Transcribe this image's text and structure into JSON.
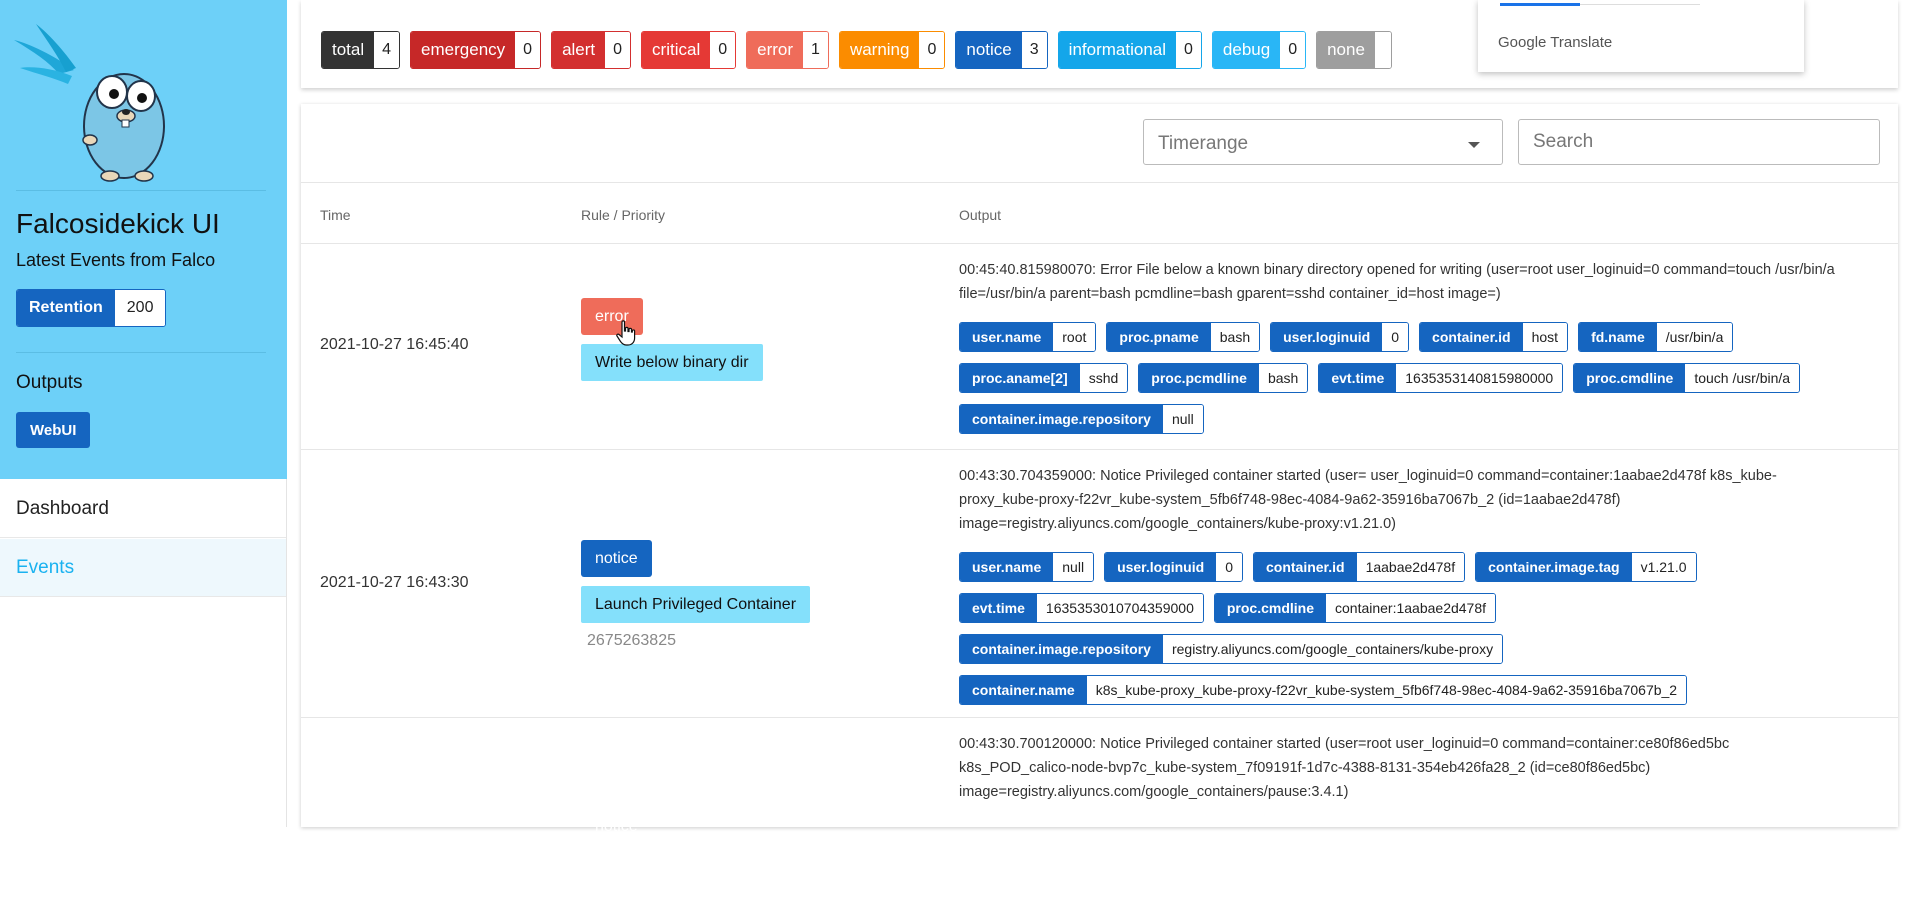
{
  "sidebar": {
    "title": "Falcosidekick UI",
    "subtitle": "Latest Events from Falco",
    "retention": {
      "label": "Retention",
      "value": "200"
    },
    "outputs_label": "Outputs",
    "outputs_button": "WebUI",
    "nav": [
      {
        "label": "Dashboard",
        "active": false
      },
      {
        "label": "Events",
        "active": true
      }
    ]
  },
  "priorities": [
    {
      "label": "total",
      "count": "4",
      "color": "#333333"
    },
    {
      "label": "emergency",
      "count": "0",
      "color": "#c62828"
    },
    {
      "label": "alert",
      "count": "0",
      "color": "#d32f2f"
    },
    {
      "label": "critical",
      "count": "0",
      "color": "#e53935"
    },
    {
      "label": "error",
      "count": "1",
      "color": "#ef6c5a"
    },
    {
      "label": "warning",
      "count": "0",
      "color": "#fb8c00"
    },
    {
      "label": "notice",
      "count": "3",
      "color": "#1565c0"
    },
    {
      "label": "informational",
      "count": "0",
      "color": "#14a6ea"
    },
    {
      "label": "debug",
      "count": "0",
      "color": "#29b6f6"
    },
    {
      "label": "none",
      "count": "",
      "color": "#9e9e9e"
    }
  ],
  "translate_popup": {
    "label": "Google Translate"
  },
  "filters": {
    "timerange_placeholder": "Timerange",
    "search_placeholder": "Search"
  },
  "table": {
    "headers": {
      "time": "Time",
      "rule": "Rule / Priority",
      "output": "Output"
    },
    "rows": [
      {
        "time": "2021-10-27 16:45:40",
        "priority": "error",
        "priority_color": "#ef6c5a",
        "rule": "Write below binary dir",
        "rule_id": "",
        "output": "00:45:40.815980070: Error File below a known binary directory opened for writing (user=root user_loginuid=0 command=touch /usr/bin/a file=/usr/bin/a parent=bash pcmdline=bash gparent=sshd container_id=host image=)",
        "fields": [
          {
            "k": "user.name",
            "v": "root"
          },
          {
            "k": "proc.pname",
            "v": "bash"
          },
          {
            "k": "user.loginuid",
            "v": "0"
          },
          {
            "k": "container.id",
            "v": "host"
          },
          {
            "k": "fd.name",
            "v": "/usr/bin/a"
          },
          {
            "k": "proc.aname[2]",
            "v": "sshd"
          },
          {
            "k": "proc.pcmdline",
            "v": "bash"
          },
          {
            "k": "evt.time",
            "v": "1635353140815980000"
          },
          {
            "k": "proc.cmdline",
            "v": "touch /usr/bin/a"
          },
          {
            "k": "container.image.repository",
            "v": "null"
          }
        ]
      },
      {
        "time": "2021-10-27 16:43:30",
        "priority": "notice",
        "priority_color": "#1565c0",
        "rule": "Launch Privileged Container",
        "rule_id": "2675263825",
        "output": "00:43:30.704359000: Notice Privileged container started (user= user_loginuid=0 command=container:1aabae2d478f k8s_kube-proxy_kube-proxy-f22vr_kube-system_5fb6f748-98ec-4084-9a62-35916ba7067b_2 (id=1aabae2d478f) image=registry.aliyuncs.com/google_containers/kube-proxy:v1.21.0)",
        "fields": [
          {
            "k": "user.name",
            "v": "null"
          },
          {
            "k": "user.loginuid",
            "v": "0"
          },
          {
            "k": "container.id",
            "v": "1aabae2d478f"
          },
          {
            "k": "container.image.tag",
            "v": "v1.21.0"
          },
          {
            "k": "evt.time",
            "v": "1635353010704359000"
          },
          {
            "k": "proc.cmdline",
            "v": "container:1aabae2d478f"
          },
          {
            "k": "container.image.repository",
            "v": "registry.aliyuncs.com/google_containers/kube-proxy"
          },
          {
            "k": "container.name",
            "v": "k8s_kube-proxy_kube-proxy-f22vr_kube-system_5fb6f748-98ec-4084-9a62-35916ba7067b_2"
          }
        ]
      },
      {
        "time": "",
        "priority": "notice",
        "priority_color": "#1565c0",
        "rule": "",
        "rule_id": "",
        "output": "00:43:30.700120000: Notice Privileged container started (user=root user_loginuid=0 command=container:ce80f86ed5bc k8s_POD_calico-node-bvp7c_kube-system_7f09191f-1d7c-4388-8131-354eb426fa28_2 (id=ce80f86ed5bc) image=registry.aliyuncs.com/google_containers/pause:3.4.1)",
        "fields": []
      }
    ]
  }
}
